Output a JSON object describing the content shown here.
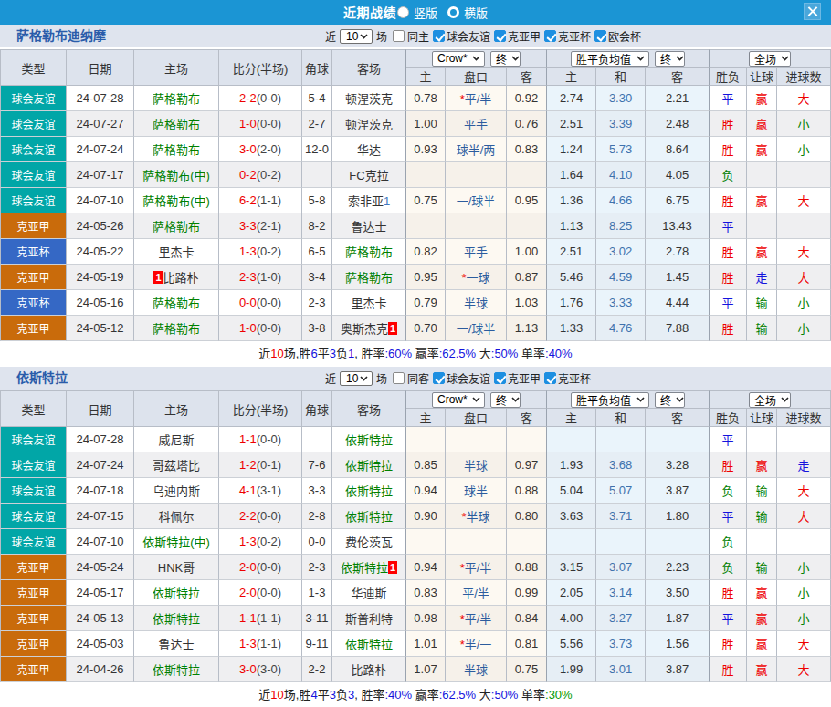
{
  "topbar": {
    "title": "近期战绩",
    "radio_vertical_label": "竖版",
    "radio_horizontal_label": "横版",
    "selected_layout": "竖版"
  },
  "filter_labels": {
    "near": "近",
    "count": "10",
    "matches": "场"
  },
  "table_header": {
    "main_cols": [
      "类型",
      "日期",
      "主场",
      "比分(半场)",
      "角球",
      "客场"
    ],
    "handicap_source_select": "Crow*",
    "handicap_final_select": "终",
    "odds_source_select": "胜平负均值",
    "odds_final_select": "终",
    "scope_select": "全场",
    "sub_cols": [
      "主",
      "盘口",
      "客",
      "主",
      "和",
      "客",
      "胜负",
      "让球",
      "进球数"
    ]
  },
  "sections": [
    {
      "team": "萨格勒布迪纳摩",
      "same_venue_label": "同主",
      "same_venue_checked": false,
      "league_filters": [
        {
          "label": "球会友谊",
          "checked": true
        },
        {
          "label": "克亚甲",
          "checked": true
        },
        {
          "label": "克亚杯",
          "checked": true
        },
        {
          "label": "欧会杯",
          "checked": true
        }
      ],
      "rows": [
        {
          "type": "球会友谊",
          "date": "24-07-28",
          "home": {
            "name": "萨格勒布",
            "green": true
          },
          "score": "2-2",
          "half": "(0-0)",
          "corner": "5-4",
          "away": {
            "name": "顿涅茨克"
          },
          "ah_home": "0.78",
          "ah_line": "平/半",
          "ah_star": true,
          "ah_away": "0.92",
          "od_home": "2.74",
          "od_draw": "3.30",
          "od_away": "2.21",
          "outcome": "平",
          "handicap_result": "赢",
          "goals_result": "大"
        },
        {
          "type": "球会友谊",
          "date": "24-07-27",
          "home": {
            "name": "萨格勒布",
            "green": true
          },
          "score": "1-0",
          "half": "(0-0)",
          "corner": "2-7",
          "away": {
            "name": "顿涅茨克"
          },
          "ah_home": "1.00",
          "ah_line": "平手",
          "ah_star": false,
          "ah_away": "0.76",
          "od_home": "2.51",
          "od_draw": "3.39",
          "od_away": "2.48",
          "outcome": "胜",
          "handicap_result": "赢",
          "goals_result": "小"
        },
        {
          "type": "球会友谊",
          "date": "24-07-24",
          "home": {
            "name": "萨格勒布",
            "green": true
          },
          "score": "3-0",
          "half": "(2-0)",
          "corner": "12-0",
          "away": {
            "name": "华达"
          },
          "ah_home": "0.93",
          "ah_line": "球半/两",
          "ah_star": false,
          "ah_away": "0.83",
          "od_home": "1.24",
          "od_draw": "5.73",
          "od_away": "8.64",
          "outcome": "胜",
          "handicap_result": "赢",
          "goals_result": "小"
        },
        {
          "type": "球会友谊",
          "date": "24-07-17",
          "home": {
            "name": "萨格勒布(中)",
            "green": true
          },
          "score": "0-2",
          "half": "(0-2)",
          "corner": "",
          "away": {
            "name": "FC克拉"
          },
          "ah_home": "",
          "ah_line": "",
          "ah_star": false,
          "ah_away": "",
          "od_home": "1.64",
          "od_draw": "4.10",
          "od_away": "4.05",
          "outcome": "负",
          "handicap_result": "",
          "goals_result": ""
        },
        {
          "type": "球会友谊",
          "date": "24-07-10",
          "home": {
            "name": "萨格勒布(中)",
            "green": true
          },
          "score": "6-2",
          "half": "(1-1)",
          "corner": "5-8",
          "away": {
            "name": "索非亚",
            "suffix": "1"
          },
          "ah_home": "0.75",
          "ah_line": "一/球半",
          "ah_star": false,
          "ah_away": "0.95",
          "od_home": "1.36",
          "od_draw": "4.66",
          "od_away": "6.75",
          "outcome": "胜",
          "handicap_result": "赢",
          "goals_result": "大"
        },
        {
          "type": "克亚甲",
          "date": "24-05-26",
          "home": {
            "name": "萨格勒布",
            "green": true
          },
          "score": "3-3",
          "half": "(2-1)",
          "corner": "8-2",
          "away": {
            "name": "鲁达士"
          },
          "ah_home": "",
          "ah_line": "",
          "ah_star": false,
          "ah_away": "",
          "od_home": "1.13",
          "od_draw": "8.25",
          "od_away": "13.43",
          "outcome": "平",
          "handicap_result": "",
          "goals_result": ""
        },
        {
          "type": "克亚杯",
          "date": "24-05-22",
          "home": {
            "name": "里杰卡"
          },
          "score": "1-3",
          "half": "(0-2)",
          "corner": "6-5",
          "away": {
            "name": "萨格勒布",
            "green": true
          },
          "ah_home": "0.82",
          "ah_line": "平手",
          "ah_star": false,
          "ah_away": "1.00",
          "od_home": "2.51",
          "od_draw": "3.02",
          "od_away": "2.78",
          "outcome": "胜",
          "handicap_result": "赢",
          "goals_result": "大"
        },
        {
          "type": "克亚甲",
          "date": "24-05-19",
          "home": {
            "name": "比路朴",
            "red_card": "1",
            "badge_side": "left"
          },
          "score": "2-3",
          "half": "(1-0)",
          "corner": "3-4",
          "away": {
            "name": "萨格勒布",
            "green": true
          },
          "ah_home": "0.95",
          "ah_line": "一球",
          "ah_star": true,
          "ah_away": "0.87",
          "od_home": "5.46",
          "od_draw": "4.59",
          "od_away": "1.45",
          "outcome": "胜",
          "handicap_result": "走",
          "goals_result": "大"
        },
        {
          "type": "克亚杯",
          "date": "24-05-16",
          "home": {
            "name": "萨格勒布",
            "green": true
          },
          "score": "0-0",
          "half": "(0-0)",
          "corner": "2-3",
          "away": {
            "name": "里杰卡"
          },
          "ah_home": "0.79",
          "ah_line": "半球",
          "ah_star": false,
          "ah_away": "1.03",
          "od_home": "1.76",
          "od_draw": "3.33",
          "od_away": "4.44",
          "outcome": "平",
          "handicap_result": "输",
          "goals_result": "小"
        },
        {
          "type": "克亚甲",
          "date": "24-05-12",
          "home": {
            "name": "萨格勒布",
            "green": true
          },
          "score": "1-0",
          "half": "(0-0)",
          "corner": "3-8",
          "away": {
            "name": "奥斯杰克",
            "red_card": "1",
            "badge_side": "right"
          },
          "ah_home": "0.70",
          "ah_line": "一/球半",
          "ah_star": false,
          "ah_away": "1.13",
          "od_home": "1.33",
          "od_draw": "4.76",
          "od_away": "7.88",
          "outcome": "胜",
          "handicap_result": "输",
          "goals_result": "小"
        }
      ],
      "summary": [
        {
          "t": "近",
          "c": "k"
        },
        {
          "t": "10",
          "c": "r"
        },
        {
          "t": "场,胜",
          "c": "k"
        },
        {
          "t": "6",
          "c": "b"
        },
        {
          "t": "平",
          "c": "k"
        },
        {
          "t": "3",
          "c": "b"
        },
        {
          "t": "负",
          "c": "k"
        },
        {
          "t": "1",
          "c": "b"
        },
        {
          "t": ", 胜率",
          "c": "k"
        },
        {
          "t": ":60%",
          "c": "b"
        },
        {
          "t": " 赢率",
          "c": "k"
        },
        {
          "t": ":62.5%",
          "c": "b"
        },
        {
          "t": " 大",
          "c": "k"
        },
        {
          "t": ":50%",
          "c": "b"
        },
        {
          "t": " 单率",
          "c": "k"
        },
        {
          "t": ":40%",
          "c": "b"
        }
      ]
    },
    {
      "team": "依斯特拉",
      "same_venue_label": "同客",
      "same_venue_checked": false,
      "league_filters": [
        {
          "label": "球会友谊",
          "checked": true
        },
        {
          "label": "克亚甲",
          "checked": true
        },
        {
          "label": "克亚杯",
          "checked": true
        }
      ],
      "rows": [
        {
          "type": "球会友谊",
          "date": "24-07-28",
          "home": {
            "name": "威尼斯"
          },
          "score": "1-1",
          "half": "(0-0)",
          "corner": "",
          "away": {
            "name": "依斯特拉",
            "green": true
          },
          "ah_home": "",
          "ah_line": "",
          "ah_star": false,
          "ah_away": "",
          "od_home": "",
          "od_draw": "",
          "od_away": "",
          "outcome": "平",
          "handicap_result": "",
          "goals_result": ""
        },
        {
          "type": "球会友谊",
          "date": "24-07-24",
          "home": {
            "name": "哥茲塔比"
          },
          "score": "1-2",
          "half": "(0-1)",
          "corner": "7-6",
          "away": {
            "name": "依斯特拉",
            "green": true
          },
          "ah_home": "0.85",
          "ah_line": "半球",
          "ah_star": false,
          "ah_away": "0.97",
          "od_home": "1.93",
          "od_draw": "3.68",
          "od_away": "3.28",
          "outcome": "胜",
          "handicap_result": "赢",
          "goals_result": "走"
        },
        {
          "type": "球会友谊",
          "date": "24-07-18",
          "home": {
            "name": "乌迪内斯"
          },
          "score": "4-1",
          "half": "(3-1)",
          "corner": "3-3",
          "away": {
            "name": "依斯特拉",
            "green": true
          },
          "ah_home": "0.94",
          "ah_line": "球半",
          "ah_star": false,
          "ah_away": "0.88",
          "od_home": "5.04",
          "od_draw": "5.07",
          "od_away": "3.87",
          "outcome": "负",
          "handicap_result": "输",
          "goals_result": "大"
        },
        {
          "type": "球会友谊",
          "date": "24-07-15",
          "home": {
            "name": "科佩尔"
          },
          "score": "2-2",
          "half": "(0-0)",
          "corner": "2-8",
          "away": {
            "name": "依斯特拉",
            "green": true
          },
          "ah_home": "0.90",
          "ah_line": "半球",
          "ah_star": true,
          "ah_away": "0.80",
          "od_home": "3.63",
          "od_draw": "3.71",
          "od_away": "1.80",
          "outcome": "平",
          "handicap_result": "输",
          "goals_result": "大"
        },
        {
          "type": "球会友谊",
          "date": "24-07-10",
          "home": {
            "name": "依斯特拉(中)",
            "green": true
          },
          "score": "1-3",
          "half": "(0-2)",
          "corner": "0-0",
          "away": {
            "name": "费伦茨瓦"
          },
          "ah_home": "",
          "ah_line": "",
          "ah_star": false,
          "ah_away": "",
          "od_home": "",
          "od_draw": "",
          "od_away": "",
          "outcome": "负",
          "handicap_result": "",
          "goals_result": ""
        },
        {
          "type": "克亚甲",
          "date": "24-05-24",
          "home": {
            "name": "HNK哥"
          },
          "score": "2-0",
          "half": "(0-0)",
          "corner": "2-3",
          "away": {
            "name": "依斯特拉",
            "green": true,
            "red_card": "1",
            "badge_side": "right"
          },
          "ah_home": "0.94",
          "ah_line": "平/半",
          "ah_star": true,
          "ah_away": "0.88",
          "od_home": "3.15",
          "od_draw": "3.07",
          "od_away": "2.23",
          "outcome": "负",
          "handicap_result": "输",
          "goals_result": "小"
        },
        {
          "type": "克亚甲",
          "date": "24-05-17",
          "home": {
            "name": "依斯特拉",
            "green": true
          },
          "score": "2-0",
          "half": "(0-0)",
          "corner": "1-3",
          "away": {
            "name": "华迪斯"
          },
          "ah_home": "0.83",
          "ah_line": "平/半",
          "ah_star": false,
          "ah_away": "0.99",
          "od_home": "2.05",
          "od_draw": "3.14",
          "od_away": "3.50",
          "outcome": "胜",
          "handicap_result": "赢",
          "goals_result": "小"
        },
        {
          "type": "克亚甲",
          "date": "24-05-13",
          "home": {
            "name": "依斯特拉",
            "green": true
          },
          "score": "1-1",
          "half": "(1-1)",
          "corner": "3-11",
          "away": {
            "name": "斯普利特"
          },
          "ah_home": "0.98",
          "ah_line": "平/半",
          "ah_star": true,
          "ah_away": "0.84",
          "od_home": "4.00",
          "od_draw": "3.27",
          "od_away": "1.87",
          "outcome": "平",
          "handicap_result": "赢",
          "goals_result": "小"
        },
        {
          "type": "克亚甲",
          "date": "24-05-03",
          "home": {
            "name": "鲁达士"
          },
          "score": "1-3",
          "half": "(1-1)",
          "corner": "9-11",
          "away": {
            "name": "依斯特拉",
            "green": true
          },
          "ah_home": "1.01",
          "ah_line": "半/一",
          "ah_star": true,
          "ah_away": "0.81",
          "od_home": "5.56",
          "od_draw": "3.73",
          "od_away": "1.56",
          "outcome": "胜",
          "handicap_result": "赢",
          "goals_result": "大"
        },
        {
          "type": "克亚甲",
          "date": "24-04-26",
          "home": {
            "name": "依斯特拉",
            "green": true
          },
          "score": "3-0",
          "half": "(3-0)",
          "corner": "2-2",
          "away": {
            "name": "比路朴"
          },
          "ah_home": "1.07",
          "ah_line": "半球",
          "ah_star": false,
          "ah_away": "0.75",
          "od_home": "1.99",
          "od_draw": "3.01",
          "od_away": "3.87",
          "outcome": "胜",
          "handicap_result": "赢",
          "goals_result": "大"
        }
      ],
      "summary": [
        {
          "t": "近",
          "c": "k"
        },
        {
          "t": "10",
          "c": "r"
        },
        {
          "t": "场,胜",
          "c": "k"
        },
        {
          "t": "4",
          "c": "b"
        },
        {
          "t": "平",
          "c": "k"
        },
        {
          "t": "3",
          "c": "b"
        },
        {
          "t": "负",
          "c": "k"
        },
        {
          "t": "3",
          "c": "b"
        },
        {
          "t": ", 胜率",
          "c": "k"
        },
        {
          "t": ":40%",
          "c": "b"
        },
        {
          "t": " 赢率",
          "c": "k"
        },
        {
          "t": ":62.5%",
          "c": "b"
        },
        {
          "t": " 大",
          "c": "k"
        },
        {
          "t": ":50%",
          "c": "b"
        },
        {
          "t": " 单率",
          "c": "k"
        },
        {
          "t": ":30%",
          "c": "g"
        }
      ]
    }
  ]
}
